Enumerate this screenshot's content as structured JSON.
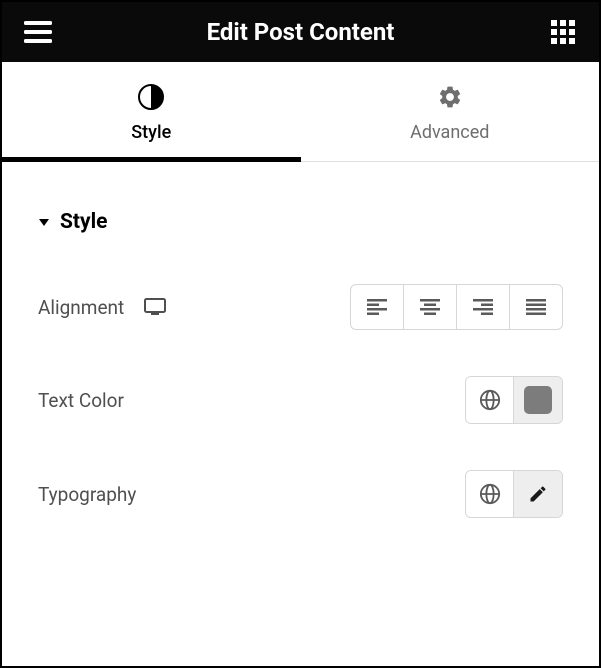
{
  "header": {
    "title": "Edit Post Content"
  },
  "tabs": [
    {
      "label": "Style",
      "active": true
    },
    {
      "label": "Advanced",
      "active": false
    }
  ],
  "section": {
    "title": "Style"
  },
  "controls": {
    "alignment": {
      "label": "Alignment"
    },
    "textColor": {
      "label": "Text Color",
      "swatch": "#7c7c7c"
    },
    "typography": {
      "label": "Typography"
    }
  }
}
